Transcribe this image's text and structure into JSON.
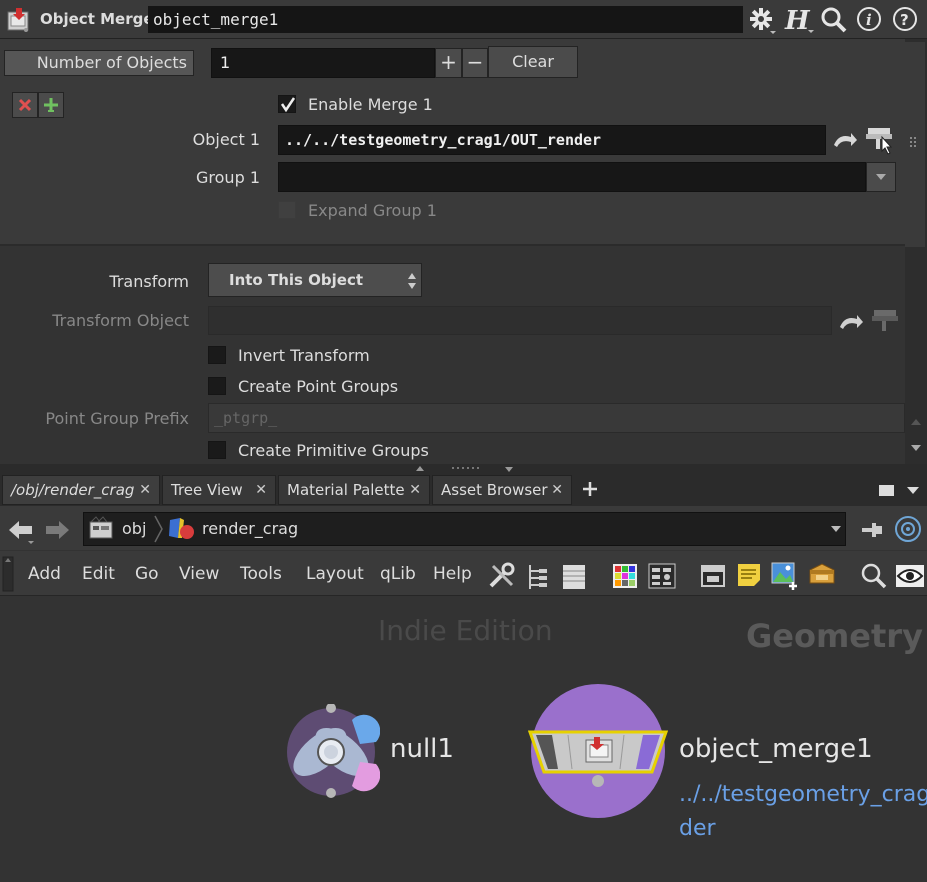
{
  "header": {
    "node_type_label": "Object Merge",
    "node_name": "object_merge1"
  },
  "params": {
    "num_objects_label": "Number of Objects",
    "num_objects_value": "1",
    "clear_label": "Clear",
    "enable_merge_label": "Enable Merge 1",
    "object1_label": "Object 1",
    "object1_value": "../../testgeometry_crag1/OUT_render",
    "group1_label": "Group 1",
    "group1_value": "",
    "expand_group_label": "Expand Group 1",
    "transform_label": "Transform",
    "transform_value": "Into This Object",
    "transform_object_label": "Transform Object",
    "invert_transform_label": "Invert Transform",
    "create_point_groups_label": "Create Point Groups",
    "point_group_prefix_label": "Point Group Prefix",
    "point_group_prefix_value": "_ptgrp_",
    "create_primitive_groups_label": "Create Primitive Groups"
  },
  "tabs": [
    {
      "label": "/obj/render_crag"
    },
    {
      "label": "Tree View"
    },
    {
      "label": "Material Palette"
    },
    {
      "label": "Asset Browser"
    }
  ],
  "path": {
    "segment1": "obj",
    "segment2": "render_crag"
  },
  "menu": [
    "Add",
    "Edit",
    "Go",
    "View",
    "Tools",
    "Layout",
    "qLib",
    "Help"
  ],
  "canvas": {
    "watermark": "Indie Edition",
    "context_label": "Geometry",
    "node1_name": "null1",
    "node2_name": "object_merge1",
    "node2_info_line1": "../../testgeometry_crag",
    "node2_info_line2": "der"
  },
  "colors": {
    "node_purple": "#9a70cc",
    "info_blue": "#6aa0e6",
    "render_flag": "#8a6bd6"
  }
}
